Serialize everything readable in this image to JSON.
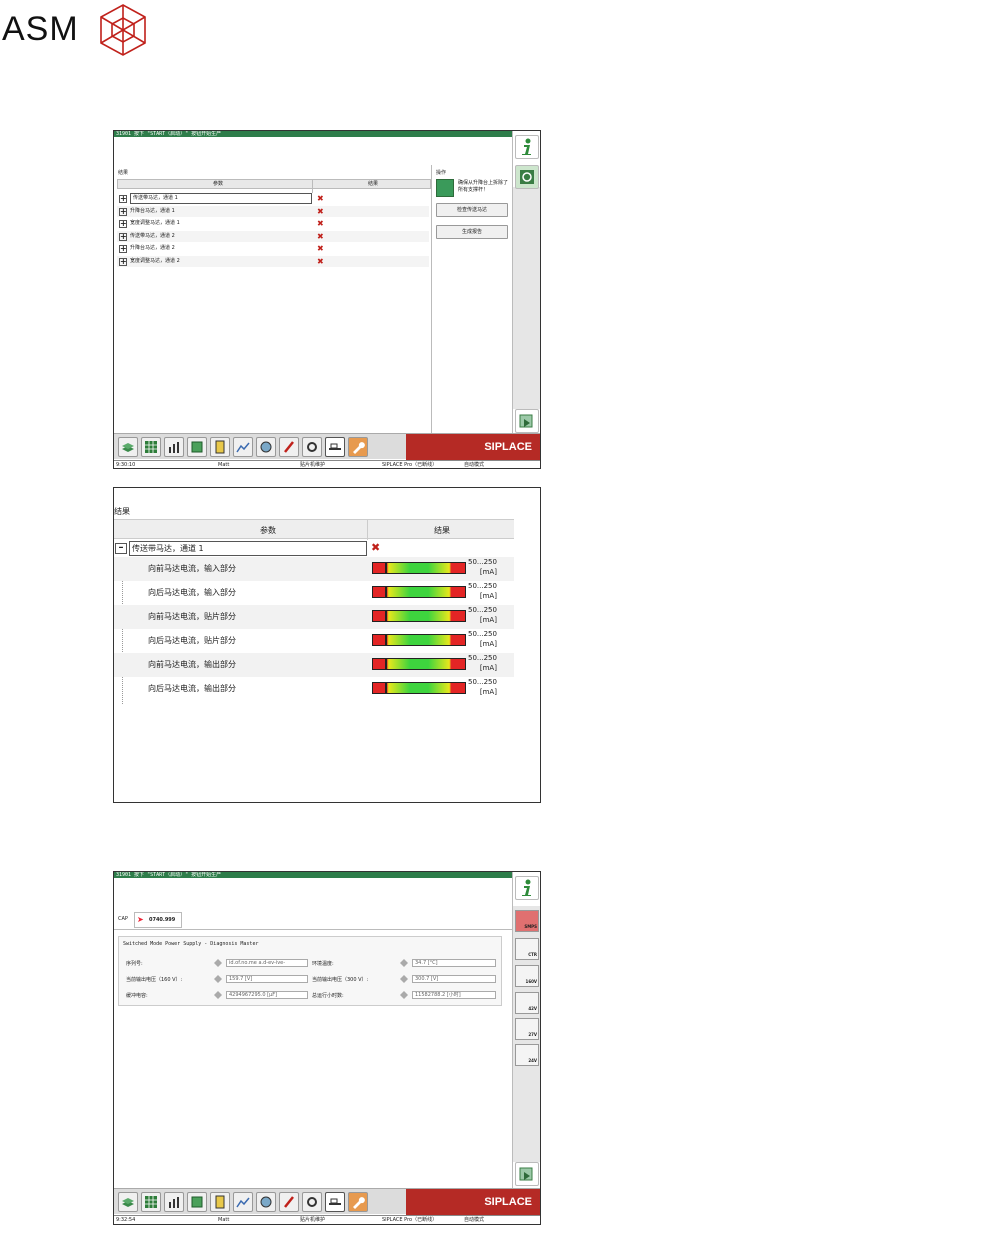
{
  "logo": {
    "text": "ASM"
  },
  "colors": {
    "accent_green": "#2e7d4a",
    "brand_red": "#b52a25",
    "error_red": "#c0211b"
  },
  "screen1": {
    "message": "31901 按下 \"START（启动）\" 按钮开始生产",
    "panel_title": "结果",
    "col_param": "参数",
    "col_result": "结果",
    "rows": [
      {
        "label": "传送带马达，通道 1",
        "result_icon": "x-icon"
      },
      {
        "label": "升降台马达，通道 1",
        "result_icon": "x-icon"
      },
      {
        "label": "宽度调整马达，通道 1",
        "result_icon": "x-icon"
      },
      {
        "label": "传送带马达，通道 2",
        "result_icon": "x-icon"
      },
      {
        "label": "升降台马达，通道 2",
        "result_icon": "x-icon"
      },
      {
        "label": "宽度调整马达，通道 2",
        "result_icon": "x-icon"
      }
    ],
    "ops_title": "操作",
    "ops_hint": "确保从升降台上拆除了所有支撑杆！",
    "btn_check": "检查传送马达",
    "btn_report": "生成报告",
    "brand": "SIPLACE",
    "status": {
      "time": "9:30:10",
      "user": "Matt",
      "mode": "贴片机维护",
      "station": "SIPLACE Pro（已断线）",
      "auto": "自动模式"
    }
  },
  "screen2": {
    "panel_title": "结果",
    "col_param": "参数",
    "col_result": "结果",
    "parent": "传送带马达，通道 1",
    "rows": [
      {
        "label": "向前马达电流，输入部分",
        "range": "50...250",
        "unit": "[mA]"
      },
      {
        "label": "向后马达电流，输入部分",
        "range": "50...250",
        "unit": "[mA]"
      },
      {
        "label": "向前马达电流，贴片部分",
        "range": "50...250",
        "unit": "[mA]"
      },
      {
        "label": "向后马达电流，贴片部分",
        "range": "50...250",
        "unit": "[mA]"
      },
      {
        "label": "向前马达电流，输出部分",
        "range": "50...250",
        "unit": "[mA]"
      },
      {
        "label": "向后马达电流，输出部分",
        "range": "50...250",
        "unit": "[mA]"
      }
    ]
  },
  "screen3": {
    "message": "31901 按下 \"START（启动）\" 按钮开始生产",
    "tab_cap": "CAP",
    "tab_id": "0740.999",
    "group_title": "Switched Mode Power Supply - Diagnosis Master",
    "fields": {
      "serial_label": "序列号:",
      "serial_value": "id.of.no.me a.d-ev-ive-",
      "temp_label": "环境温度:",
      "temp_value": "34.7 [°C]",
      "v160_label": "当前输出电压（160 V）:",
      "v160_value": "159.7 [V]",
      "v300_label": "当前输出电压（300 V）:",
      "v300_value": "300.7 [V]",
      "cap_label": "缓冲电容:",
      "cap_value": "4294967295.0 [µF]",
      "hours_label": "总运行小时数:",
      "hours_value": "11582788.2 [小时]"
    },
    "side_tabs": [
      "SMPS",
      "CTR",
      "160V",
      "42V",
      "27V",
      "24V"
    ],
    "brand": "SIPLACE",
    "status": {
      "time": "9:32:54",
      "user": "Matt",
      "mode": "贴片机维护",
      "station": "SIPLACE Pro（已断线）",
      "auto": "自动模式"
    }
  }
}
